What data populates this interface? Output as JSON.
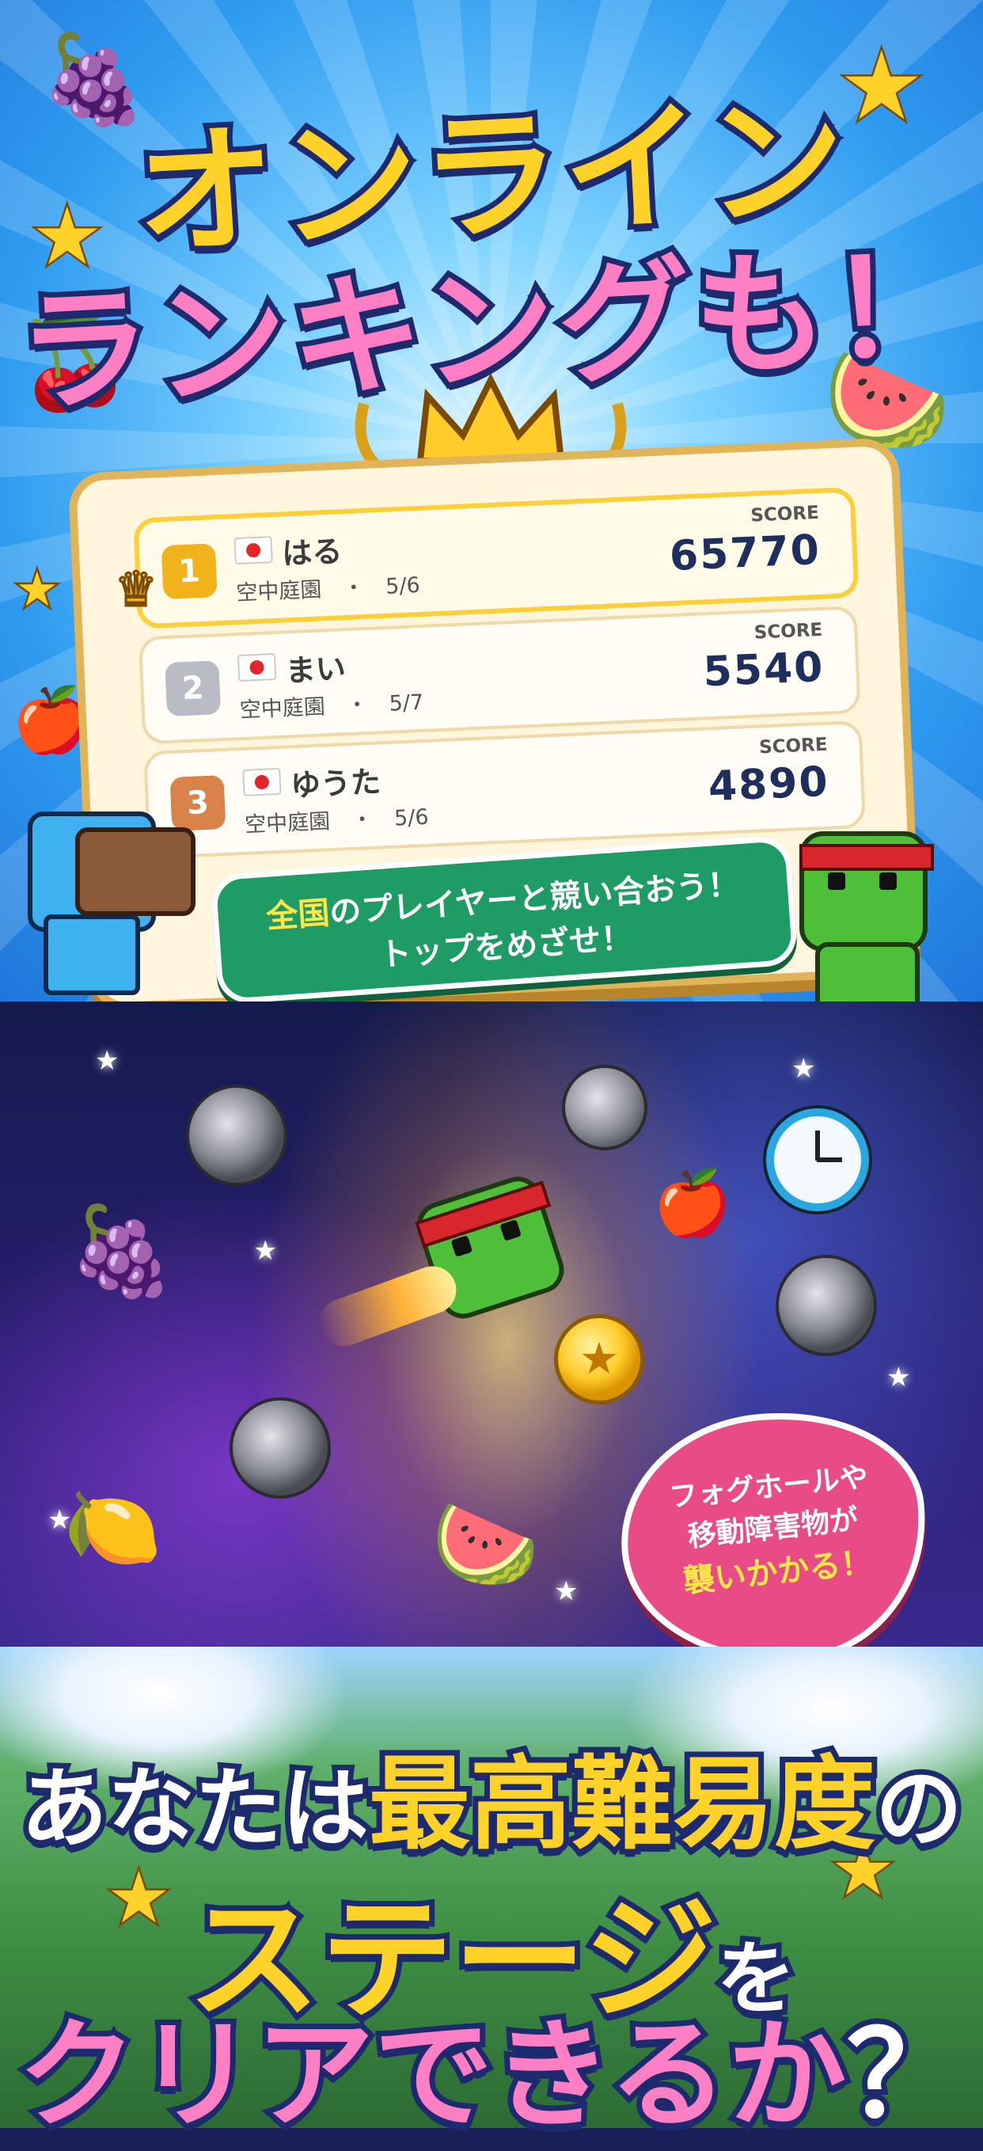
{
  "headline_top": {
    "line1": "オンライン",
    "line2": "ランキングも！"
  },
  "ranking": {
    "score_label": "SCORE",
    "rows": [
      {
        "rank": "1",
        "name": "はる",
        "stage": "空中庭園　・　5/6",
        "score": "65770"
      },
      {
        "rank": "2",
        "name": "まい",
        "stage": "空中庭園　・　5/7",
        "score": "5540"
      },
      {
        "rank": "3",
        "name": "ゆうた",
        "stage": "空中庭園　・　5/6",
        "score": "4890"
      }
    ]
  },
  "banner": {
    "line1_highlight": "全国",
    "line1_rest": "のプレイヤーと競い合おう！",
    "line2": "トップをめざせ！"
  },
  "burst": {
    "line1": "フォグホールや",
    "line2": "移動障害物が",
    "line3": "襲いかかる！"
  },
  "headline_bottom": {
    "l1_a": "あなたは",
    "l1_b": "最高難易度",
    "l1_c": "の",
    "l2_a": "ステージ",
    "l2_b": "を",
    "l3_a": "クリアできるか",
    "l3_b": "？"
  },
  "icons": {
    "crown": "crown-icon",
    "grape": "🍇",
    "cherry": "🍒",
    "watermelon": "🍉",
    "apple": "🍎",
    "lemon": "🍋",
    "star_glyph": "★",
    "small_crown": "♛"
  },
  "colors": {
    "rank1": "#f2b21b",
    "rank2": "#b9bcc4",
    "rank3": "#d9834a"
  }
}
